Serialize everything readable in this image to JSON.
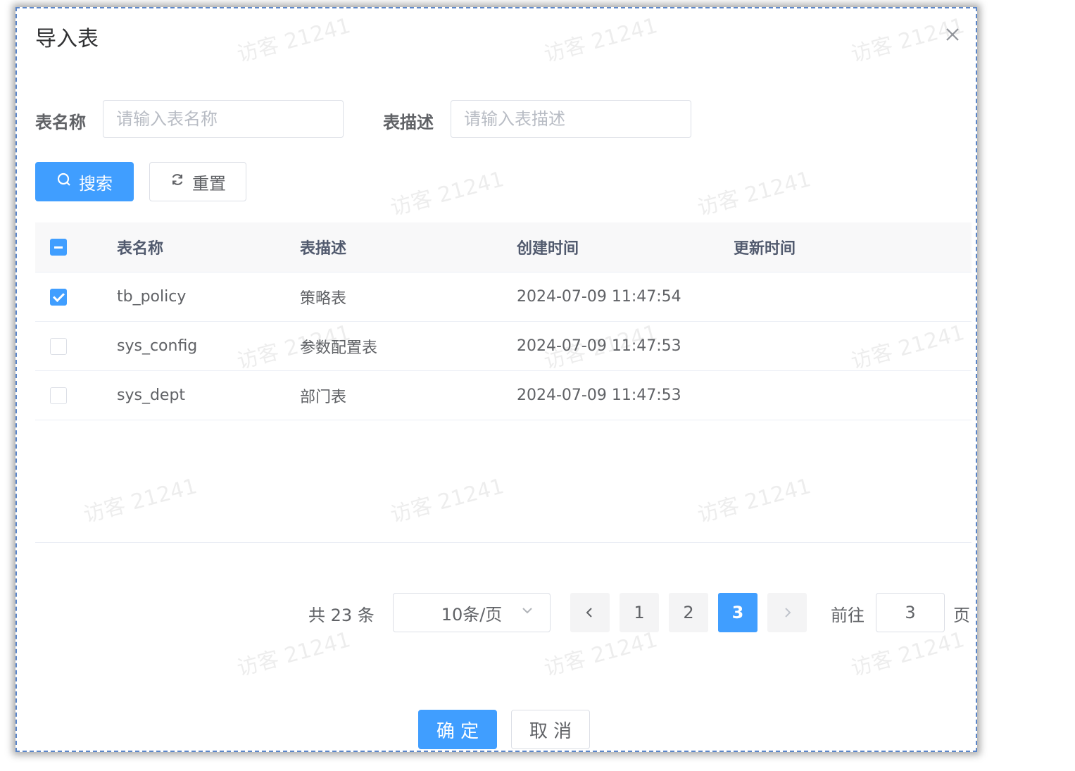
{
  "dialog": {
    "title": "导入表",
    "close_icon": "close-icon"
  },
  "watermark_text": "访客 21241",
  "search_form": {
    "table_name_label": "表名称",
    "table_name_placeholder": "请输入表名称",
    "table_name_value": "",
    "table_desc_label": "表描述",
    "table_desc_placeholder": "请输入表描述",
    "table_desc_value": "",
    "search_label": "搜索",
    "reset_label": "重置"
  },
  "table": {
    "columns": [
      "表名称",
      "表描述",
      "创建时间",
      "更新时间"
    ],
    "header_checkbox_state": "indeterminate",
    "rows": [
      {
        "checked": true,
        "name": "tb_policy",
        "desc": "策略表",
        "created": "2024-07-09 11:47:54",
        "updated": ""
      },
      {
        "checked": false,
        "name": "sys_config",
        "desc": "参数配置表",
        "created": "2024-07-09 11:47:53",
        "updated": ""
      },
      {
        "checked": false,
        "name": "sys_dept",
        "desc": "部门表",
        "created": "2024-07-09 11:47:53",
        "updated": ""
      }
    ]
  },
  "pagination": {
    "total_text": "共 23 条",
    "page_size_text": "10条/页",
    "prev_icon": "chevron-left-icon",
    "next_icon": "chevron-right-icon",
    "pages": [
      "1",
      "2",
      "3"
    ],
    "current_page": "3",
    "goto_label": "前往",
    "goto_value": "3",
    "page_suffix": "页"
  },
  "footer": {
    "confirm_label": "确 定",
    "cancel_label": "取 消"
  },
  "colors": {
    "primary": "#409eff",
    "border": "#dcdfe6",
    "dialog_border": "#5b86c9"
  }
}
